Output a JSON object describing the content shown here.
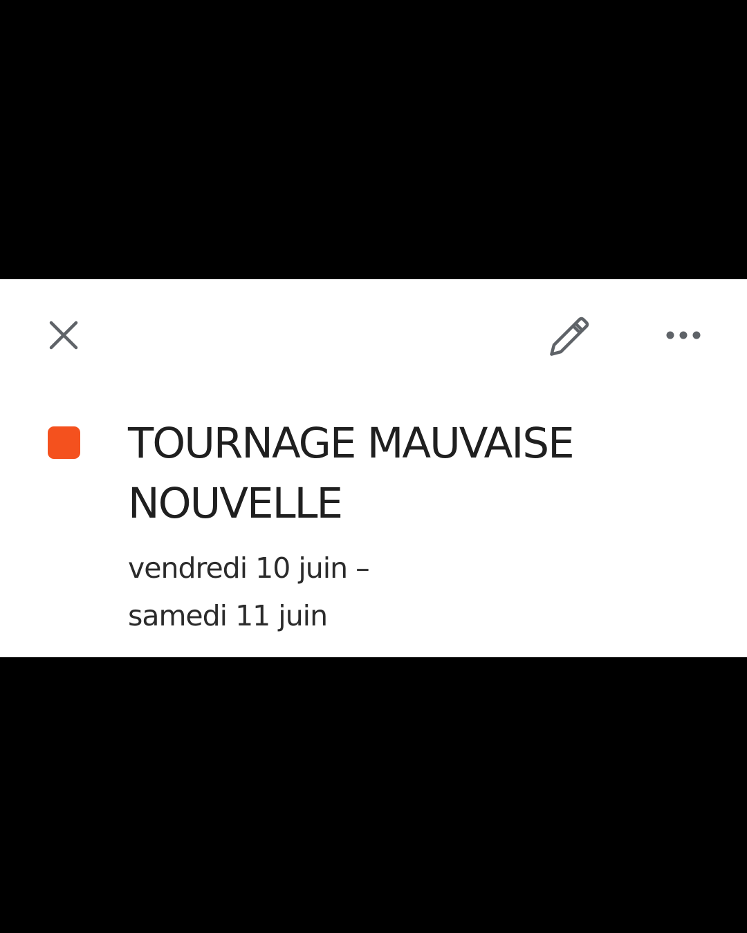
{
  "event": {
    "color": "#f4511e",
    "title_line1": "TOURNAGE MAUVAISE",
    "title_line2": "NOUVELLE",
    "date_line1": "vendredi 10 juin –",
    "date_line2": "samedi 11 juin"
  },
  "toolbar": {
    "close_icon": "close-icon",
    "edit_icon": "pencil-icon",
    "more_icon": "more-horizontal-icon"
  },
  "colors": {
    "background": "#000000",
    "card": "#ffffff",
    "icon": "#5f6368",
    "text": "#1f1f1f"
  }
}
